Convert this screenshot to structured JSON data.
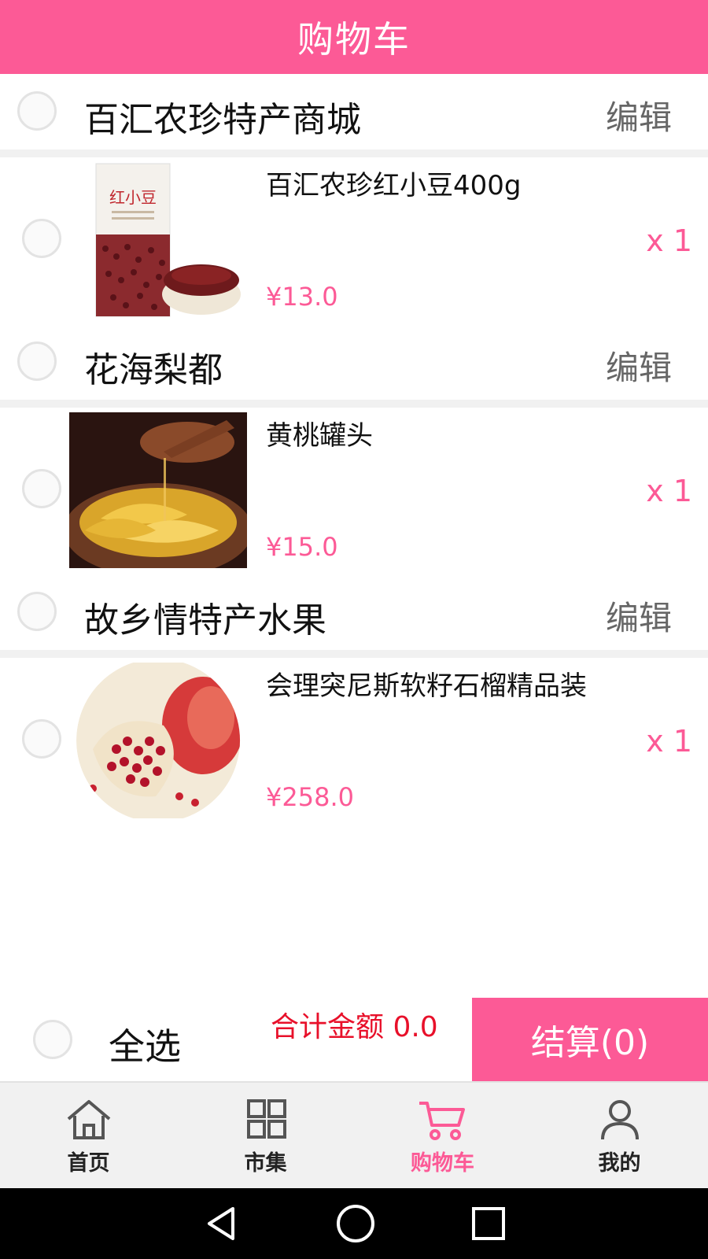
{
  "header": {
    "title": "购物车"
  },
  "shops": [
    {
      "name": "百汇农珍特产商城",
      "edit_label": "编辑",
      "items": [
        {
          "name": "百汇农珍红小豆400g",
          "price": "¥13.0",
          "qty": "x 1",
          "image_text": "红小豆"
        }
      ]
    },
    {
      "name": "花海梨都",
      "edit_label": "编辑",
      "items": [
        {
          "name": "黄桃罐头",
          "price": "¥15.0",
          "qty": "x 1"
        }
      ]
    },
    {
      "name": "故乡情特产水果",
      "edit_label": "编辑",
      "items": [
        {
          "name": "会理突尼斯软籽石榴精品装",
          "price": "¥258.0",
          "qty": "x 1"
        }
      ]
    }
  ],
  "footer": {
    "select_all": "全选",
    "total": "合计金额 0.0",
    "checkout": "结算(0)"
  },
  "tabs": [
    {
      "label": "首页",
      "icon": "home-icon"
    },
    {
      "label": "市集",
      "icon": "grid-icon"
    },
    {
      "label": "购物车",
      "icon": "cart-icon",
      "active": true
    },
    {
      "label": "我的",
      "icon": "person-icon"
    }
  ],
  "colors": {
    "accent": "#fc5a96",
    "total_red": "#e8102a",
    "tab_bg": "#f1f1f1"
  }
}
